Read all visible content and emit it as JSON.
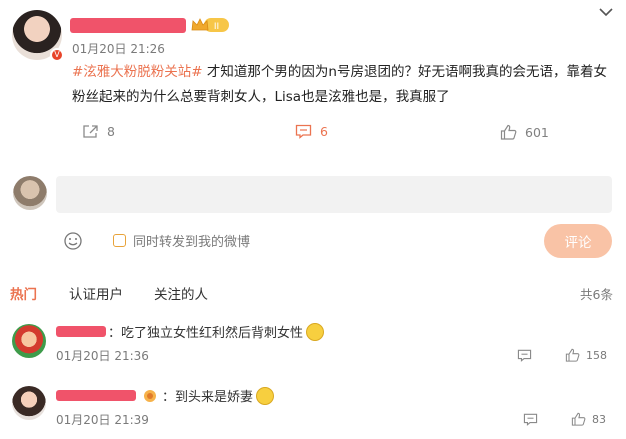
{
  "post": {
    "verified_badge": "V",
    "vip_label": "II",
    "time": "01月20日 21:26",
    "tag": "#泫雅大粉脱粉关站#",
    "body": "才知道那个男的因为n号房退团的？好无语啊我真的会无语，靠着女粉丝起来的为什么总要背刺女人，Lisa也是泫雅也是，我真服了",
    "share_count": "8",
    "comment_count": "6",
    "like_count": "601"
  },
  "composer": {
    "placeholder": "",
    "repost_label": "同时转发到我的微博",
    "submit_label": "评论"
  },
  "tabs": {
    "hot": "热门",
    "verified": "认证用户",
    "following": "关注的人",
    "total": "共6条"
  },
  "comments": [
    {
      "text": "：吃了独立女性红利然后背刺女性",
      "time": "01月20日 21:36",
      "likes": "158"
    },
    {
      "text": "：到头来是娇妻",
      "time": "01月20日 21:39",
      "likes": "83"
    }
  ],
  "colors": {
    "accent": "#eb7350",
    "redaction": "#f0536a",
    "input_bg": "#f2f2f2",
    "submit_bg": "#f9c3a6"
  },
  "icons": [
    "chevron-down-icon",
    "share-icon",
    "comment-icon",
    "like-icon",
    "emoji-icon",
    "vip-crown-icon"
  ]
}
